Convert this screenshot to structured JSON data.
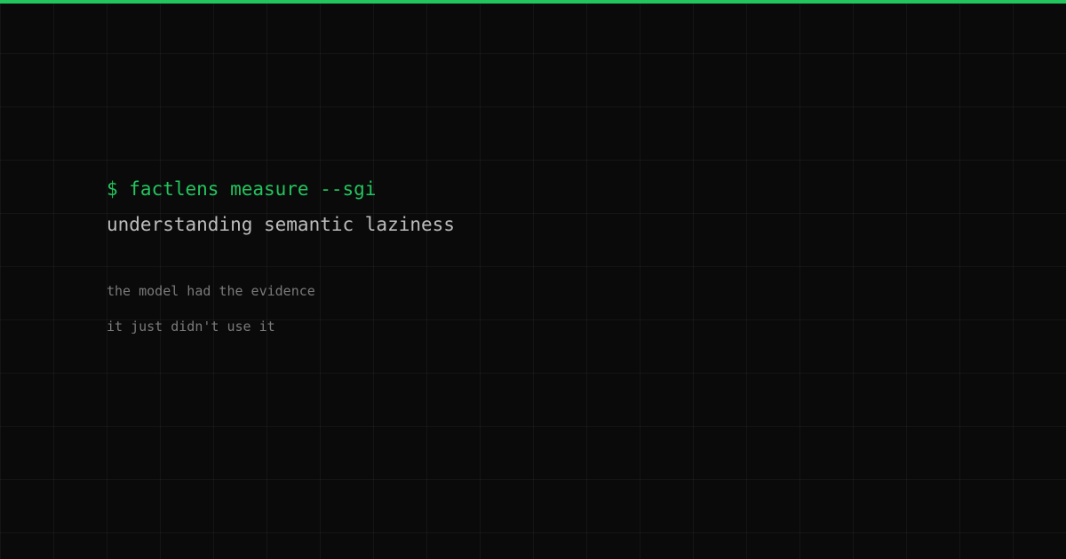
{
  "colors": {
    "background": "#0a0a0a",
    "accent": "#22c55e",
    "title_text": "#bdbdbd",
    "muted_text": "#7a7a7a"
  },
  "terminal": {
    "command": "$ factlens measure --sgi",
    "title": "understanding semantic laziness",
    "lines": [
      "the model had the evidence",
      "it just didn't use it"
    ]
  }
}
